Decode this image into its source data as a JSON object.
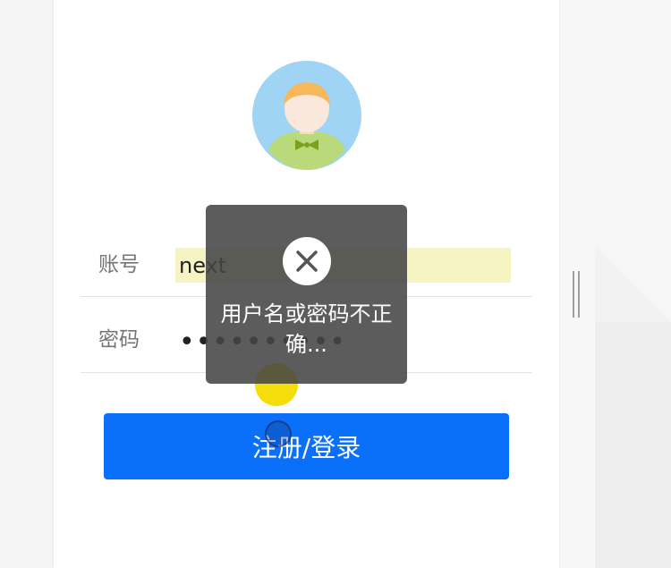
{
  "login_form": {
    "account_label": "账号",
    "account_value": "next",
    "password_label": "密码",
    "password_value": "••••••••••",
    "submit_label": "注册/登录"
  },
  "toast": {
    "icon": "close-circle-icon",
    "message": "用户名或密码不正确..."
  },
  "avatar": {
    "icon": "user-avatar-icon"
  },
  "colors": {
    "primary_button": "#0b70f9",
    "autofill_background": "#f6f4c2",
    "toast_background": "#464646",
    "tap_indicator": "#f5dd0b",
    "avatar_background": "#9fd4f5"
  }
}
